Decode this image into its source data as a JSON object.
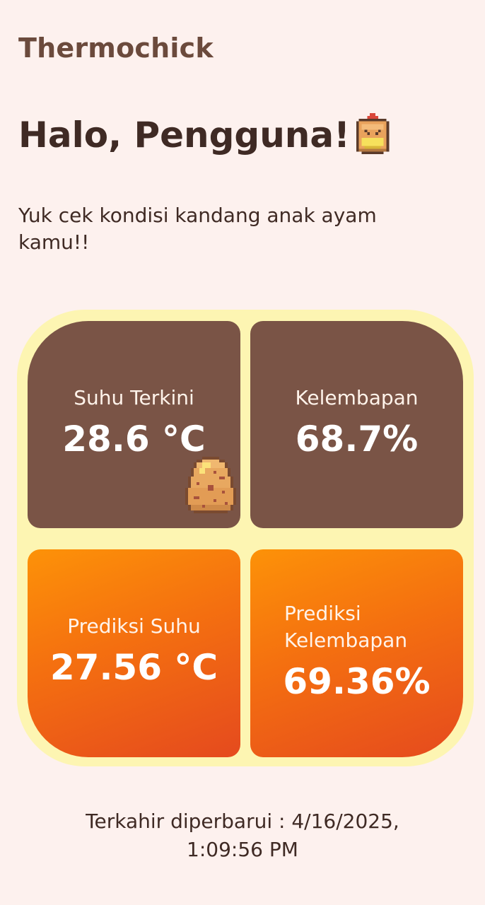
{
  "app": {
    "title": "Thermochick"
  },
  "greeting": {
    "text": "Halo, Pengguna!",
    "icon": "chick-icon"
  },
  "subtitle": "Yuk cek kondisi kandang anak ayam kamu!!",
  "cards": {
    "current_temp": {
      "label": "Suhu Terkini",
      "value": "28.6 °C",
      "icon": "egg-icon"
    },
    "current_humidity": {
      "label": "Kelembapan",
      "value": "68.7%"
    },
    "predicted_temp": {
      "label": "Prediksi Suhu",
      "value": "27.56 °C"
    },
    "predicted_humidity": {
      "label": "Prediksi Kelembapan",
      "value": "69.36%"
    }
  },
  "footer": {
    "updated_label": "Terkahir diperbarui : 4/16/2025,",
    "updated_time": "1:09:56 PM"
  },
  "colors": {
    "background": "#fdf1ee",
    "frame": "#fdf5b2",
    "card_brown": "#7a5446",
    "card_orange_top": "#fd9208",
    "card_orange_bottom": "#e54a1e",
    "title": "#6b4a3c"
  }
}
